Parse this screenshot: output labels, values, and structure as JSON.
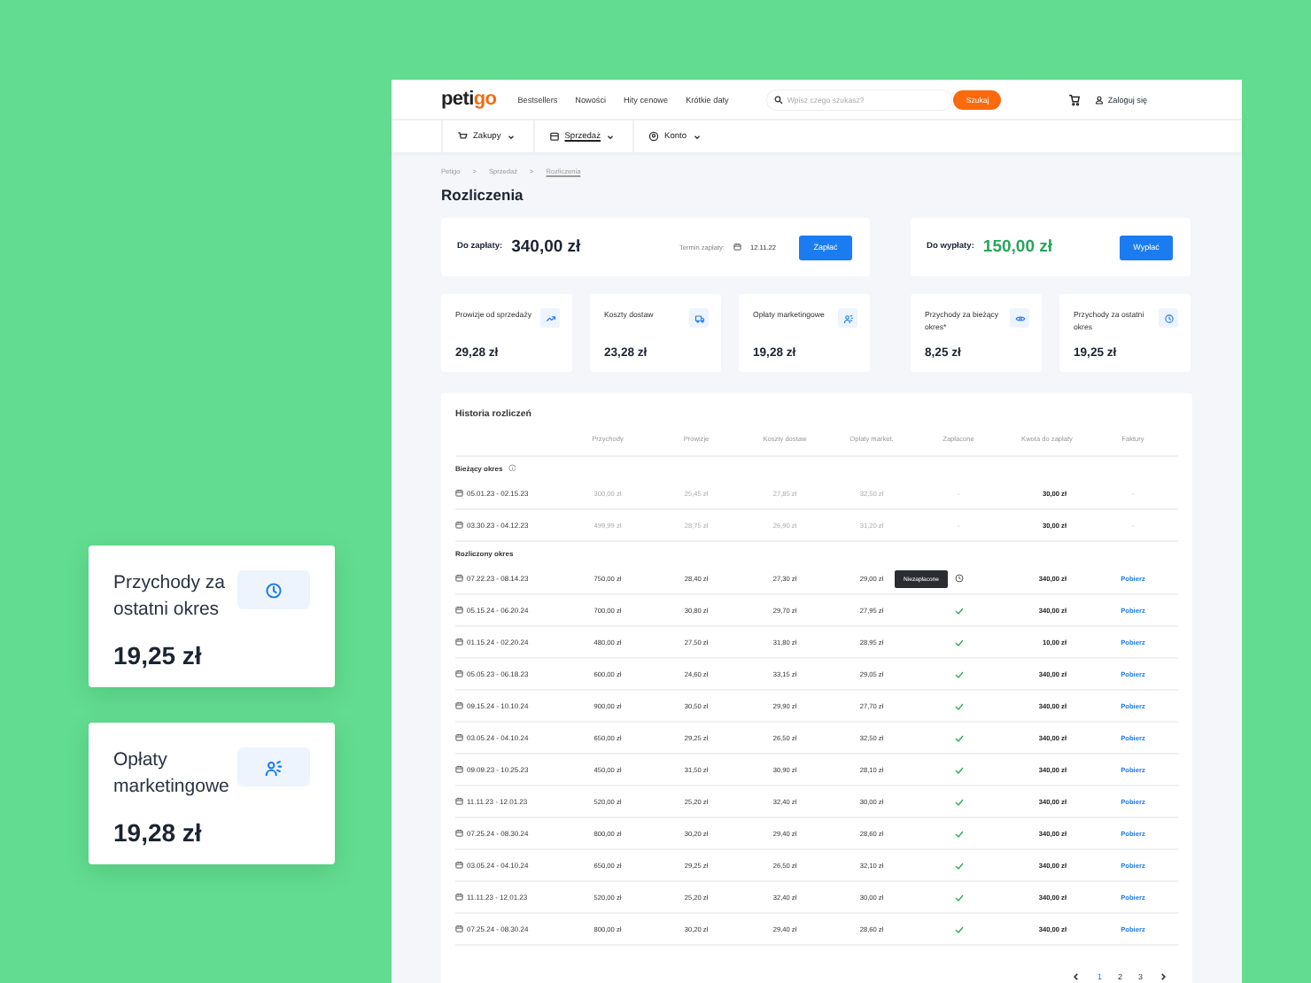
{
  "header": {
    "logo": {
      "main": "peti",
      "accent": "go"
    },
    "nav_links": [
      "Bestsellers",
      "Nowości",
      "Hity cenowe",
      "Krótkie daty"
    ],
    "search": {
      "placeholder": "Wpisz czego szukasz?",
      "button": "Szukaj"
    },
    "login": "Zaloguj się"
  },
  "subnav": [
    {
      "label": "Zakupy",
      "selected": false
    },
    {
      "label": "Sprzedaż",
      "selected": true
    },
    {
      "label": "Konto",
      "selected": false
    }
  ],
  "breadcrumb": [
    {
      "label": "Petigo",
      "current": false
    },
    {
      "label": "Sprzedaż",
      "current": false
    },
    {
      "label": "Rozliczenia",
      "current": true
    }
  ],
  "breadcrumb_separator": ">",
  "title": "Rozliczenia",
  "payment_card": {
    "label": "Do zapłaty:",
    "amount": "340,00 zł",
    "due_label": "Termin zapłaty:",
    "due_date": "12.11.22",
    "button": "Zapłać"
  },
  "payment_stats": [
    {
      "label": "Prowizje od sprzedaży",
      "value": "29,28 zł"
    },
    {
      "label": "Koszty dostaw",
      "value": "23,28 zł"
    },
    {
      "label": "Opłaty marketingowe",
      "value": "19,28 zł"
    }
  ],
  "payout_card": {
    "label": "Do wypłaty:",
    "amount": "150,00 zł",
    "button": "Wypłać"
  },
  "payout_stats": [
    {
      "label": "Przychody za bieżący okres*",
      "value": "8,25 zł"
    },
    {
      "label": "Przychody za ostatni okres",
      "value": "19,25 zł"
    }
  ],
  "table": {
    "title": "Historia rozliczeń",
    "columns": [
      "Przychody",
      "Prowizje",
      "Koszty dostaw",
      "Opłaty market.",
      "Zapłacone",
      "Kwota do zapłaty",
      "Faktury"
    ],
    "sections": [
      {
        "title": "Bieżący okres",
        "kind": "current",
        "rows": [
          {
            "date": "05.01.23 - 02.15.23",
            "revenue": "300,00 zł",
            "commission": "25,45 zł",
            "shipping": "27,85 zł",
            "marketing": "32,50 zł",
            "paid": {
              "kind": "dash",
              "text": "-"
            },
            "amount": "30,00 zł",
            "invoice": {
              "kind": "dash",
              "text": "-"
            }
          },
          {
            "date": "03.30.23 - 04.12.23",
            "revenue": "499,99 zł",
            "commission": "28,75 zł",
            "shipping": "26,90 zł",
            "marketing": "31,20 zł",
            "paid": {
              "kind": "dash",
              "text": "-"
            },
            "amount": "30,00 zł",
            "invoice": {
              "kind": "dash",
              "text": "-"
            }
          }
        ]
      },
      {
        "title": "Rozliczony okres",
        "kind": "settled",
        "rows": [
          {
            "date": "07.22.23 - 08.14.23",
            "revenue": "750,00 zł",
            "commission": "28,40 zł",
            "shipping": "27,30 zł",
            "marketing": "29,00 zł",
            "paid": {
              "kind": "unpaid",
              "tooltip": "Niezapłacone"
            },
            "amount": "340,00 zł",
            "invoice": {
              "kind": "link",
              "text": "Pobierz"
            }
          },
          {
            "date": "05.15.24 - 06.20.24",
            "revenue": "700,00 zł",
            "commission": "30,80 zł",
            "shipping": "29,70 zł",
            "marketing": "27,95 zł",
            "paid": {
              "kind": "paid"
            },
            "amount": "340,00 zł",
            "invoice": {
              "kind": "link",
              "text": "Pobierz"
            }
          },
          {
            "date": "01.15.24 - 02.20.24",
            "revenue": "480,00 zł",
            "commission": "27,50 zł",
            "shipping": "31,80 zł",
            "marketing": "28,95 zł",
            "paid": {
              "kind": "paid"
            },
            "amount": "10,00 zł",
            "invoice": {
              "kind": "link",
              "text": "Pobierz"
            }
          },
          {
            "date": "05.05.23 - 06.18.23",
            "revenue": "600,00 zł",
            "commission": "24,60 zł",
            "shipping": "33,15 zł",
            "marketing": "29,05 zł",
            "paid": {
              "kind": "paid"
            },
            "amount": "340,00 zł",
            "invoice": {
              "kind": "link",
              "text": "Pobierz"
            }
          },
          {
            "date": "09.15.24 - 10.10.24",
            "revenue": "900,00 zł",
            "commission": "30,50 zł",
            "shipping": "29,90 zł",
            "marketing": "27,70 zł",
            "paid": {
              "kind": "paid"
            },
            "amount": "340,00 zł",
            "invoice": {
              "kind": "link",
              "text": "Pobierz"
            }
          },
          {
            "date": "03.05.24 - 04.10.24",
            "revenue": "650,00 zł",
            "commission": "29,25 zł",
            "shipping": "26,50 zł",
            "marketing": "32,50 zł",
            "paid": {
              "kind": "paid"
            },
            "amount": "340,00 zł",
            "invoice": {
              "kind": "link",
              "text": "Pobierz"
            }
          },
          {
            "date": "09.09.23 - 10.25.23",
            "revenue": "450,00 zł",
            "commission": "31,50 zł",
            "shipping": "30,90 zł",
            "marketing": "28,10 zł",
            "paid": {
              "kind": "paid"
            },
            "amount": "340,00 zł",
            "invoice": {
              "kind": "link",
              "text": "Pobierz"
            }
          },
          {
            "date": "11.11.23 - 12.01.23",
            "revenue": "520,00 zł",
            "commission": "25,20 zł",
            "shipping": "32,40 zł",
            "marketing": "30,00 zł",
            "paid": {
              "kind": "paid"
            },
            "amount": "340,00 zł",
            "invoice": {
              "kind": "link",
              "text": "Pobierz"
            }
          },
          {
            "date": "07.25.24 - 08.30.24",
            "revenue": "800,00 zł",
            "commission": "30,20 zł",
            "shipping": "29,40 zł",
            "marketing": "28,60 zł",
            "paid": {
              "kind": "paid"
            },
            "amount": "340,00 zł",
            "invoice": {
              "kind": "link",
              "text": "Pobierz"
            }
          },
          {
            "date": "03.05.24 - 04.10.24",
            "revenue": "650,00 zł",
            "commission": "29,25 zł",
            "shipping": "26,50 zł",
            "marketing": "32,10 zł",
            "paid": {
              "kind": "paid"
            },
            "amount": "340,00 zł",
            "invoice": {
              "kind": "link",
              "text": "Pobierz"
            }
          },
          {
            "date": "11.11.23 - 12.01.23",
            "revenue": "520,00 zł",
            "commission": "25,20 zł",
            "shipping": "32,40 zł",
            "marketing": "30,00 zł",
            "paid": {
              "kind": "paid"
            },
            "amount": "340,00 zł",
            "invoice": {
              "kind": "link",
              "text": "Pobierz"
            }
          },
          {
            "date": "07.25.24 - 08.30.24",
            "revenue": "800,00 zł",
            "commission": "30,20 zł",
            "shipping": "29,40 zł",
            "marketing": "28,60 zł",
            "paid": {
              "kind": "paid"
            },
            "amount": "340,00 zł",
            "invoice": {
              "kind": "link",
              "text": "Pobierz"
            }
          }
        ]
      }
    ]
  },
  "pagination": [
    {
      "label": "1",
      "selected": true
    },
    {
      "label": "2",
      "selected": false
    },
    {
      "label": "3",
      "selected": false
    }
  ],
  "floating_cards": [
    {
      "label": "Przychody za ostatni okres",
      "value": "19,25 zł"
    },
    {
      "label": "Opłaty marketingowe",
      "value": "19,28 zł"
    }
  ]
}
